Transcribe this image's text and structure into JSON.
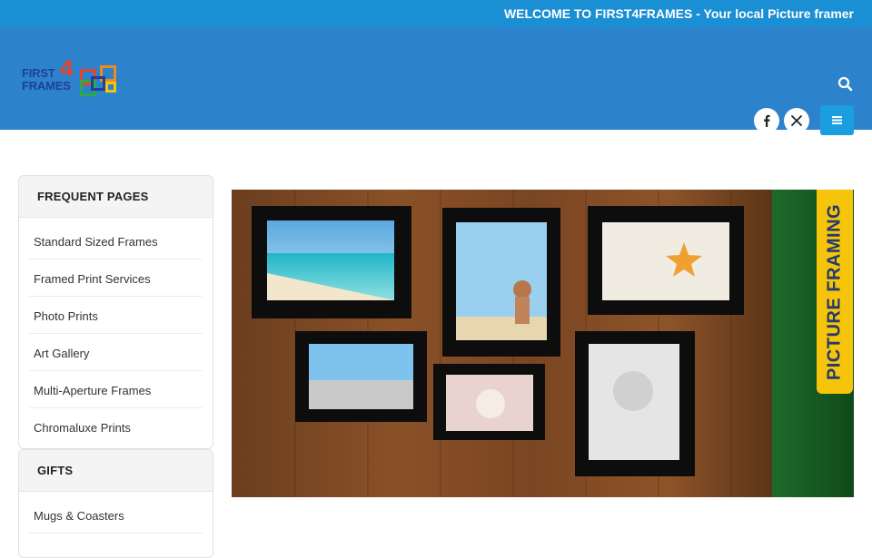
{
  "topbar": {
    "welcome": "WELCOME TO FIRST4FRAMES - Your local Picture framer"
  },
  "header": {
    "logo": {
      "line1": "FIRST",
      "digit": "4",
      "line2": "FRAMES"
    },
    "icons": {
      "search": "search-icon",
      "facebook": "facebook-icon",
      "x": "x-twitter-icon",
      "menu": "menu-icon"
    }
  },
  "sidebar": {
    "frequent": {
      "title": "FREQUENT PAGES",
      "items": [
        "Standard Sized Frames",
        "Framed Print Services",
        "Photo Prints",
        "Art Gallery",
        "Multi-Aperture Frames",
        "Chromaluxe Prints"
      ]
    },
    "gifts": {
      "title": "GIFTS",
      "items": [
        "Mugs & Coasters"
      ]
    }
  },
  "banner": {
    "label": "PICTURE FRAMING"
  },
  "colors": {
    "topbar": "#1a8fd3",
    "header": "#2c83cc",
    "menu_button": "#1a9ee0",
    "banner_tag": "#f6c40a"
  }
}
